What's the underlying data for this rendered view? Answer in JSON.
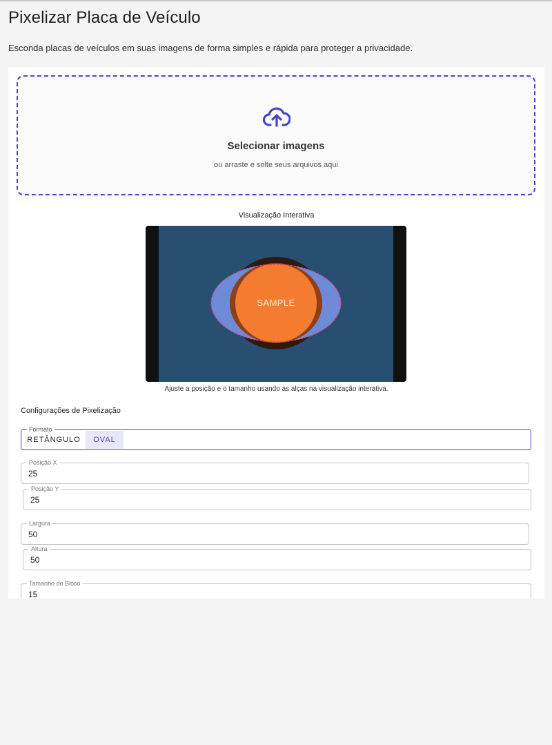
{
  "page": {
    "title": "Pixelizar Placa de Veículo",
    "subtitle": "Esconda placas de veículos em suas imagens de forma simples e rápida para proteger a privacidade."
  },
  "dropzone": {
    "icon": "cloud-upload-icon",
    "title": "Selecionar imagens",
    "hint": "ou arraste e solte seus arquivos aqui"
  },
  "preview": {
    "title": "Visualização Interativa",
    "sample_text": "SAMPLE",
    "caption": "Ajuste a posição e o tamanho usando as alças na visualização interativa."
  },
  "settings": {
    "title": "Configurações de Pixelização",
    "format": {
      "label": "Formato",
      "options": [
        "RETÂNGULO",
        "OVAL"
      ],
      "selected": "OVAL"
    },
    "fields": {
      "pos_x": {
        "label": "Posição X",
        "value": "25"
      },
      "pos_y": {
        "label": "Posição Y",
        "value": "25"
      },
      "width": {
        "label": "Largura",
        "value": "50"
      },
      "height": {
        "label": "Altura",
        "value": "50"
      },
      "block_size": {
        "label": "Tamanho do Bloco",
        "value": "15"
      }
    }
  },
  "colors": {
    "accent": "#4844c8",
    "preview_background": "#284f72",
    "sample_orange": "#f47c30",
    "selection_fill": "#6f8ad6",
    "selection_outline": "#e0407e"
  }
}
